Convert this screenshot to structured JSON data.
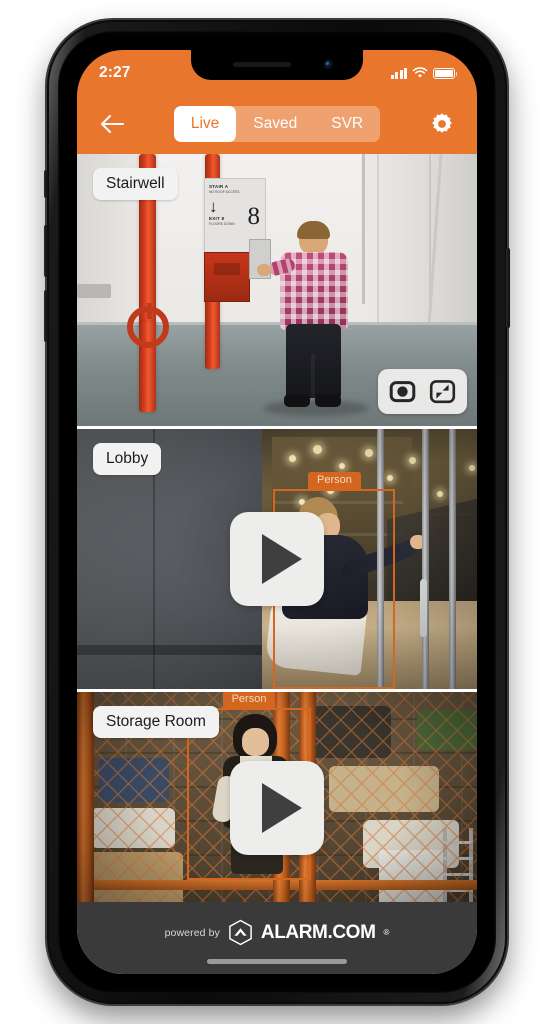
{
  "status_bar": {
    "time": "2:27",
    "signal_icon": "cellular-signal-icon",
    "wifi_icon": "wifi-icon",
    "battery_icon": "battery-full-icon"
  },
  "nav_bar": {
    "back_icon": "back-arrow-icon",
    "settings_icon": "gear-icon",
    "tabs": [
      {
        "label": "Live",
        "active": true
      },
      {
        "label": "Saved",
        "active": false
      },
      {
        "label": "SVR",
        "active": false
      }
    ]
  },
  "cameras": [
    {
      "name": "Stairwell",
      "state": "live",
      "detection": null,
      "sign": {
        "line1": "STAIR A",
        "line2": "NO ROOF ACCESS",
        "line3": "EXIT 8",
        "line4": "FLOORS DOWN",
        "floor_number": "8"
      },
      "controls": [
        {
          "icon": "snapshot-icon",
          "name": "snapshot-button"
        },
        {
          "icon": "collapse-icon",
          "name": "collapse-button"
        }
      ]
    },
    {
      "name": "Lobby",
      "state": "paused",
      "detection": {
        "label": "Person"
      },
      "play_icon": "play-icon"
    },
    {
      "name": "Storage Room",
      "state": "paused",
      "detection": {
        "label": "Person"
      },
      "play_icon": "play-icon"
    }
  ],
  "footer": {
    "powered_by": "powered by",
    "brand": "ALARM.COM",
    "registered_mark": "®",
    "logo_icon": "alarm-hexagon-logo-icon",
    "home_indicator": "home-indicator"
  },
  "colors": {
    "accent_orange": "#e8762c",
    "detection_orange": "#d4661f",
    "footer_dark": "#3a3a3a",
    "label_bg": "#f2f2f2"
  }
}
